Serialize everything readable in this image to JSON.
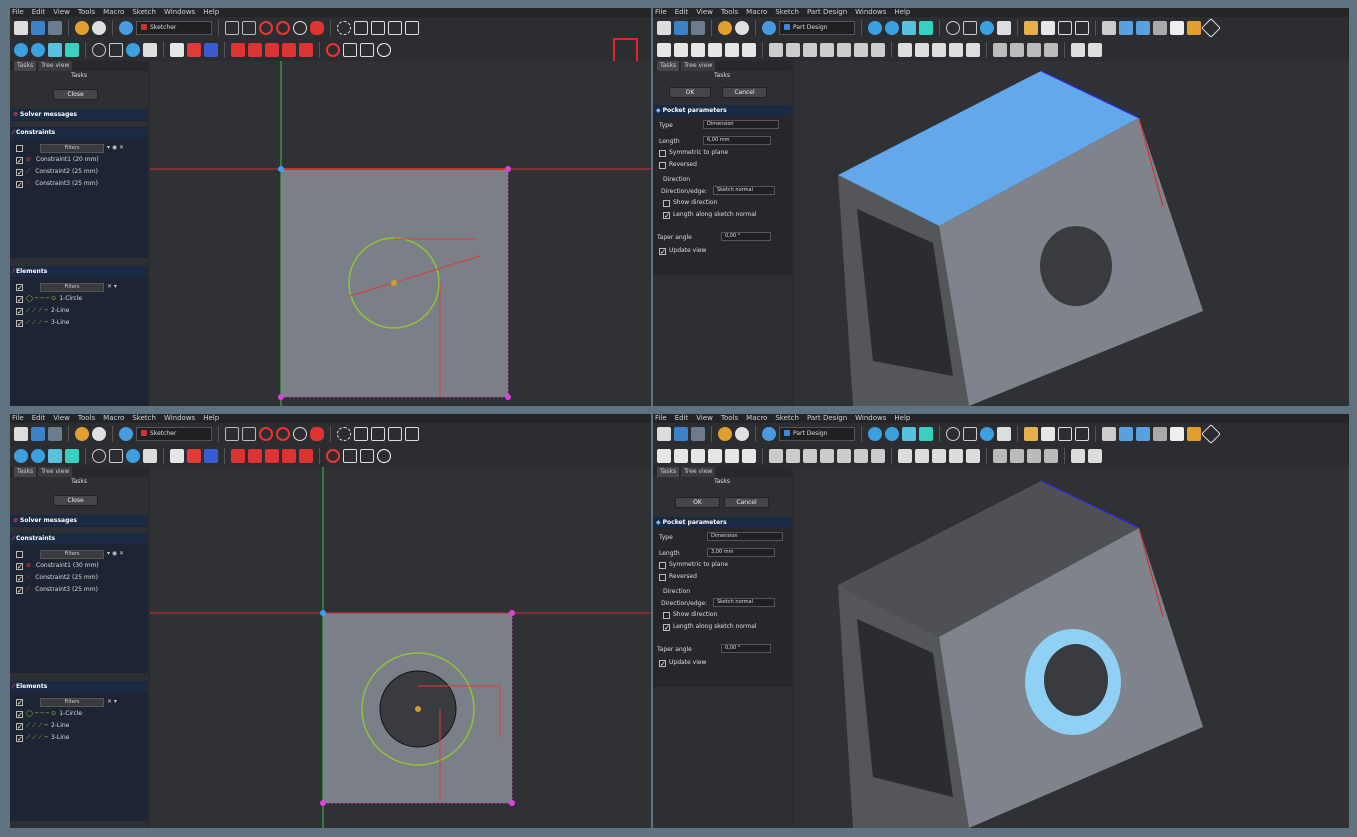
{
  "menus": {
    "sketch": [
      "File",
      "Edit",
      "View",
      "Tools",
      "Macro",
      "Sketch",
      "Windows",
      "Help"
    ],
    "partdesign": [
      "File",
      "Edit",
      "View",
      "Tools",
      "Macro",
      "Sketch",
      "Part Design",
      "Windows",
      "Help"
    ]
  },
  "workbench": {
    "sketcher": "Sketcher",
    "partdesign": "Part Design"
  },
  "tabs": {
    "tasks": "Tasks",
    "tree": "Tree view"
  },
  "panel_title": "Tasks",
  "sketch_panel": {
    "close_button": "Close",
    "solver_messages": "Solver messages",
    "constraints": "Constraints",
    "elements": "Elements",
    "filters": "Filters",
    "constraints_top": [
      "Constraint1 (20 mm)",
      "Constraint2 (25 mm)",
      "Constraint3 (25 mm)"
    ],
    "constraints_bottom": [
      "Constraint1 (30 mm)",
      "Constraint2 (25 mm)",
      "Constraint3 (25 mm)"
    ],
    "elements_list": [
      "1-Circle",
      "2-Line",
      "3-Line"
    ]
  },
  "pocket_panel": {
    "ok": "OK",
    "cancel": "Cancel",
    "title": "Pocket parameters",
    "type_label": "Type",
    "type_value": "Dimension",
    "length_label": "Length",
    "length_top": "6,00 mm",
    "length_bottom": "3,00 mm",
    "symmetric": "Symmetric to plane",
    "reversed": "Reversed",
    "direction_group": "Direction",
    "direction_edge_label": "Direction/edge:",
    "direction_edge_value": "Sketch normal",
    "show_direction": "Show direction",
    "length_along": "Length along sketch normal",
    "taper_label": "Taper angle",
    "taper_value": "0,00 °",
    "update_view": "Update view"
  },
  "colors": {
    "background": "#5e7282",
    "face_highlight": "#64a8ec",
    "ring_highlight": "#8fd0f4",
    "sketch_face": "#7a7f88",
    "construction_green": "#8ec43a",
    "dimension_red": "#e03b3b"
  }
}
